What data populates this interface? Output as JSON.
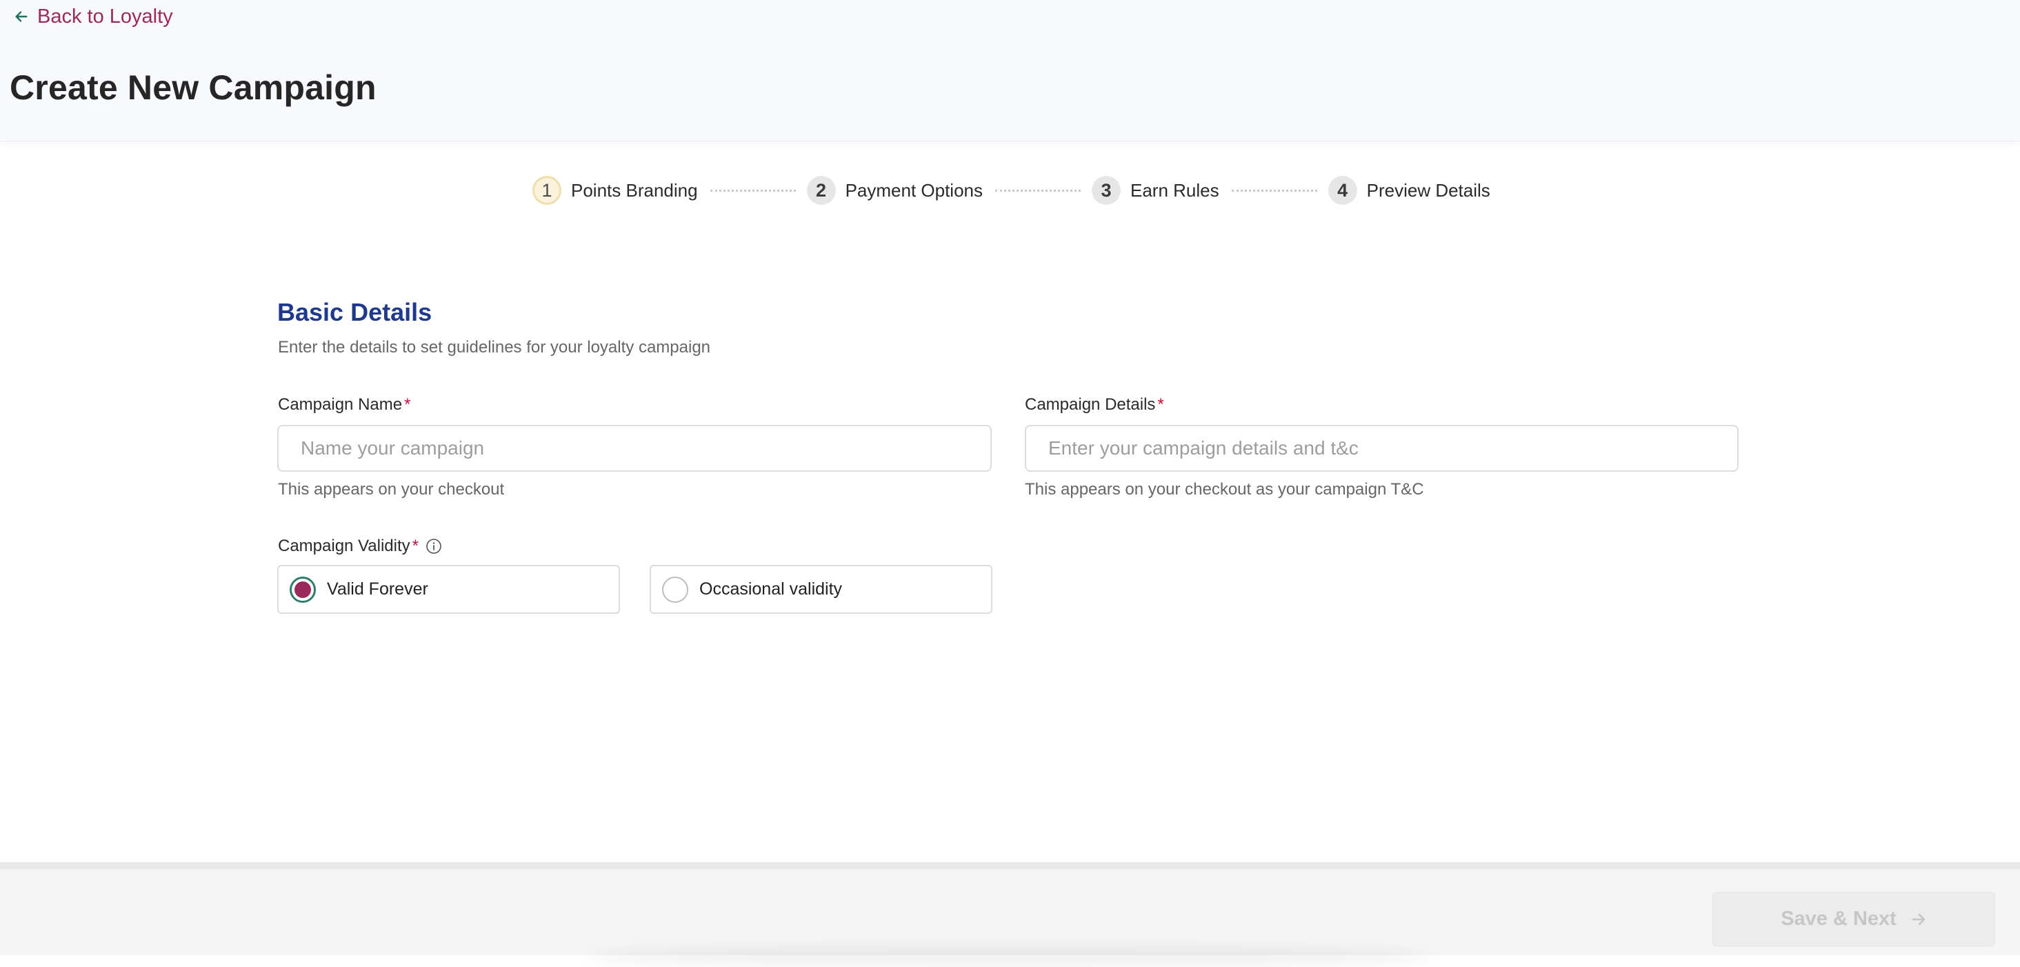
{
  "header": {
    "back_label": "Back to Loyalty",
    "title": "Create New Campaign"
  },
  "stepper": {
    "steps": [
      {
        "number": "1",
        "label": "Points Branding",
        "active": true
      },
      {
        "number": "2",
        "label": "Payment Options",
        "active": false
      },
      {
        "number": "3",
        "label": "Earn Rules",
        "active": false
      },
      {
        "number": "4",
        "label": "Preview Details",
        "active": false
      }
    ]
  },
  "section": {
    "title": "Basic Details",
    "subtitle": "Enter the details to set guidelines for your loyalty campaign"
  },
  "form": {
    "campaign_name": {
      "label": "Campaign Name",
      "required_mark": "*",
      "placeholder": "Name your campaign",
      "value": "",
      "helper": "This appears on your checkout"
    },
    "campaign_details": {
      "label": "Campaign Details",
      "required_mark": "*",
      "placeholder": "Enter your campaign details and t&c",
      "value": "",
      "helper": "This appears on your checkout as your campaign T&C"
    },
    "campaign_validity": {
      "label": "Campaign Validity",
      "required_mark": "*",
      "options": [
        {
          "label": "Valid Forever",
          "selected": true
        },
        {
          "label": "Occasional validity",
          "selected": false
        }
      ]
    }
  },
  "footer": {
    "save_label": "Save & Next",
    "save_enabled": false
  },
  "colors": {
    "brand": "#9a2a5a",
    "accent_green": "#2e7c6b",
    "section_title": "#1f3a8a",
    "required": "#c4123a"
  }
}
